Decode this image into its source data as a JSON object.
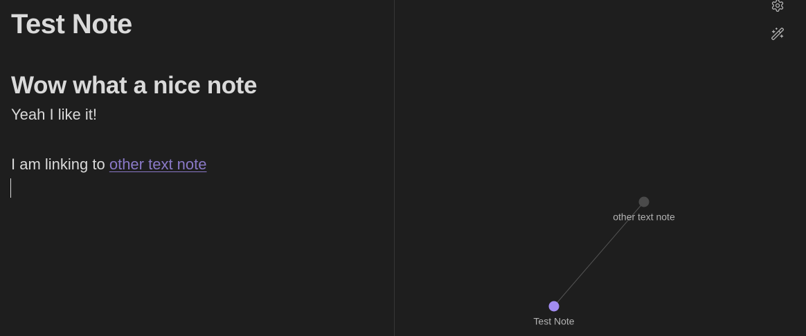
{
  "editor": {
    "title": "Test Note",
    "heading": "Wow what a nice note",
    "paragraph_1": "Yeah I like it!",
    "paragraph_2_prefix": "I am linking to ",
    "link_text": "other text note"
  },
  "graph": {
    "nodes": [
      {
        "label": "other text note",
        "active": false,
        "color": "#4a4a4a"
      },
      {
        "label": "Test Note",
        "active": true,
        "color": "#a28cf2"
      }
    ],
    "edges": [
      {
        "from": "Test Note",
        "to": "other text note"
      }
    ],
    "icons": [
      "gear-icon",
      "magic-wand-icon"
    ]
  },
  "colors": {
    "background": "#1e1e1e",
    "text": "#dadada",
    "link": "#8a79c7",
    "active_node": "#a28cf2",
    "inactive_node": "#4a4a4a",
    "edge": "#555555"
  }
}
